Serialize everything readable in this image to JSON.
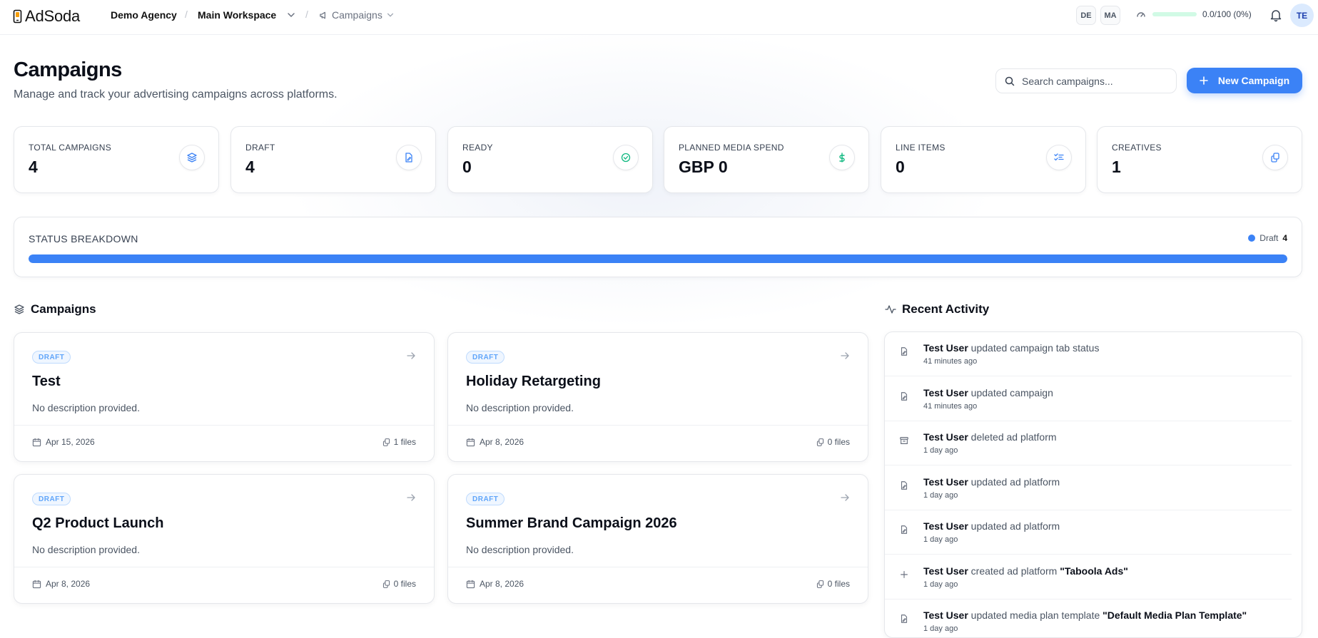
{
  "app": {
    "name": "AdSoda"
  },
  "breadcrumb": {
    "agency": "Demo Agency",
    "workspace": "Main Workspace",
    "section": "Campaigns"
  },
  "topbar": {
    "pills": [
      "DE",
      "MA"
    ],
    "quota": {
      "text": "0.0/100 (0%)",
      "fraction": 0.0
    },
    "avatar": "TE"
  },
  "header": {
    "title": "Campaigns",
    "subtitle": "Manage and track your advertising campaigns across platforms.",
    "search_placeholder": "Search campaigns...",
    "new_button": "New Campaign"
  },
  "stats": [
    {
      "label": "TOTAL CAMPAIGNS",
      "value": "4",
      "icon": "layers-icon"
    },
    {
      "label": "DRAFT",
      "value": "4",
      "icon": "file-edit-icon"
    },
    {
      "label": "READY",
      "value": "0",
      "icon": "check-circle-icon"
    },
    {
      "label": "PLANNED MEDIA SPEND",
      "value": "GBP 0",
      "icon": "dollar-icon"
    },
    {
      "label": "LINE ITEMS",
      "value": "0",
      "icon": "list-checks-icon"
    },
    {
      "label": "CREATIVES",
      "value": "1",
      "icon": "copy-icon"
    }
  ],
  "status_breakdown": {
    "title": "STATUS BREAKDOWN",
    "legend": [
      {
        "label": "Draft",
        "count": "4",
        "color": "#3b82f6",
        "fraction": 1.0
      }
    ]
  },
  "campaigns_section": {
    "title": "Campaigns"
  },
  "campaigns": [
    {
      "badge": "DRAFT",
      "name": "Test",
      "description": "No description provided.",
      "date": "Apr 15, 2026",
      "files": "1 files"
    },
    {
      "badge": "DRAFT",
      "name": "Holiday Retargeting",
      "description": "No description provided.",
      "date": "Apr 8, 2026",
      "files": "0 files"
    },
    {
      "badge": "DRAFT",
      "name": "Q2 Product Launch",
      "description": "No description provided.",
      "date": "Apr 8, 2026",
      "files": "0 files"
    },
    {
      "badge": "DRAFT",
      "name": "Summer Brand Campaign 2026",
      "description": "No description provided.",
      "date": "Apr 8, 2026",
      "files": "0 files"
    }
  ],
  "activity_section": {
    "title": "Recent Activity"
  },
  "activity": [
    {
      "user": "Test User",
      "action": " updated campaign tab status",
      "target": "",
      "time": "41 minutes ago",
      "icon": "file-edit-icon"
    },
    {
      "user": "Test User",
      "action": " updated campaign",
      "target": "",
      "time": "41 minutes ago",
      "icon": "file-edit-icon"
    },
    {
      "user": "Test User",
      "action": " deleted ad platform",
      "target": "",
      "time": "1 day ago",
      "icon": "archive-icon"
    },
    {
      "user": "Test User",
      "action": " updated ad platform",
      "target": "",
      "time": "1 day ago",
      "icon": "file-edit-icon"
    },
    {
      "user": "Test User",
      "action": " updated ad platform",
      "target": "",
      "time": "1 day ago",
      "icon": "file-edit-icon"
    },
    {
      "user": "Test User",
      "action": " created ad platform ",
      "target": "\"Taboola Ads\"",
      "time": "1 day ago",
      "icon": "plus-icon"
    },
    {
      "user": "Test User",
      "action": " updated media plan template ",
      "target": "\"Default Media Plan Template\"",
      "time": "1 day ago",
      "icon": "file-edit-icon"
    }
  ],
  "colors": {
    "accent": "#3b82f6",
    "success": "#10b981",
    "border": "#e5e7eb"
  }
}
